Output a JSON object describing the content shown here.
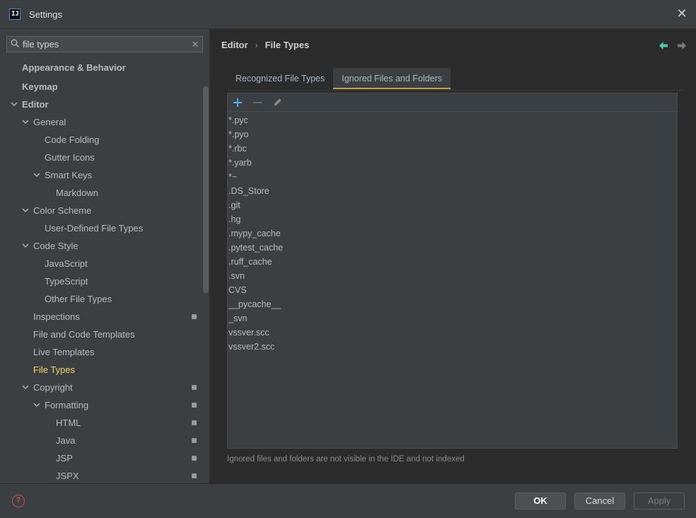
{
  "window": {
    "title": "Settings",
    "app_icon_text": "IJ"
  },
  "search": {
    "value": "file types"
  },
  "tree": [
    {
      "label": "Appearance & Behavior",
      "bold": true,
      "expanded": null,
      "badge": false
    },
    {
      "label": "Keymap",
      "bold": true,
      "expanded": null,
      "badge": false
    },
    {
      "label": "Editor",
      "bold": true,
      "expanded": true,
      "badge": false
    },
    {
      "label": "General",
      "bold": false,
      "expanded": true,
      "badge": false
    },
    {
      "label": "Code Folding",
      "bold": false,
      "expanded": null,
      "badge": false
    },
    {
      "label": "Gutter Icons",
      "bold": false,
      "expanded": null,
      "badge": false
    },
    {
      "label": "Smart Keys",
      "bold": false,
      "expanded": true,
      "badge": false
    },
    {
      "label": "Markdown",
      "bold": false,
      "expanded": null,
      "badge": false
    },
    {
      "label": "Color Scheme",
      "bold": false,
      "expanded": true,
      "badge": false
    },
    {
      "label": "User-Defined File Types",
      "bold": false,
      "expanded": null,
      "badge": false
    },
    {
      "label": "Code Style",
      "bold": false,
      "expanded": true,
      "badge": false
    },
    {
      "label": "JavaScript",
      "bold": false,
      "expanded": null,
      "badge": false
    },
    {
      "label": "TypeScript",
      "bold": false,
      "expanded": null,
      "badge": false
    },
    {
      "label": "Other File Types",
      "bold": false,
      "expanded": null,
      "badge": false
    },
    {
      "label": "Inspections",
      "bold": false,
      "expanded": null,
      "badge": true
    },
    {
      "label": "File and Code Templates",
      "bold": false,
      "expanded": null,
      "badge": false
    },
    {
      "label": "Live Templates",
      "bold": false,
      "expanded": null,
      "badge": false
    },
    {
      "label": "File Types",
      "bold": false,
      "expanded": null,
      "badge": false,
      "selected": true
    },
    {
      "label": "Copyright",
      "bold": false,
      "expanded": true,
      "badge": true
    },
    {
      "label": "Formatting",
      "bold": false,
      "expanded": true,
      "badge": true
    },
    {
      "label": "HTML",
      "bold": false,
      "expanded": null,
      "badge": true
    },
    {
      "label": "Java",
      "bold": false,
      "expanded": null,
      "badge": true
    },
    {
      "label": "JSP",
      "bold": false,
      "expanded": null,
      "badge": true
    },
    {
      "label": "JSPX",
      "bold": false,
      "expanded": null,
      "badge": true
    }
  ],
  "breadcrumb": {
    "parent": "Editor",
    "separator": "›",
    "current": "File Types"
  },
  "tabs": [
    {
      "label": "Recognized File Types",
      "active": false
    },
    {
      "label": "Ignored Files and Folders",
      "active": true
    }
  ],
  "ignored_list": [
    "*.pyc",
    "*.pyo",
    "*.rbc",
    "*.yarb",
    "*~",
    ".DS_Store",
    ".git",
    ".hg",
    ".mypy_cache",
    ".pytest_cache",
    ".ruff_cache",
    ".svn",
    "CVS",
    "__pycache__",
    "_svn",
    "vssver.scc",
    "vssver2.scc"
  ],
  "hint": "Ignored files and folders are not visible in the IDE and not indexed",
  "buttons": {
    "ok": "OK",
    "cancel": "Cancel",
    "apply": "Apply"
  },
  "colors": {
    "accent_add": "#4eade5",
    "selected_text": "#f5d566",
    "tab_underline": "#c9a542",
    "help": "#c75450",
    "nav_back": "#4ec9b0"
  }
}
